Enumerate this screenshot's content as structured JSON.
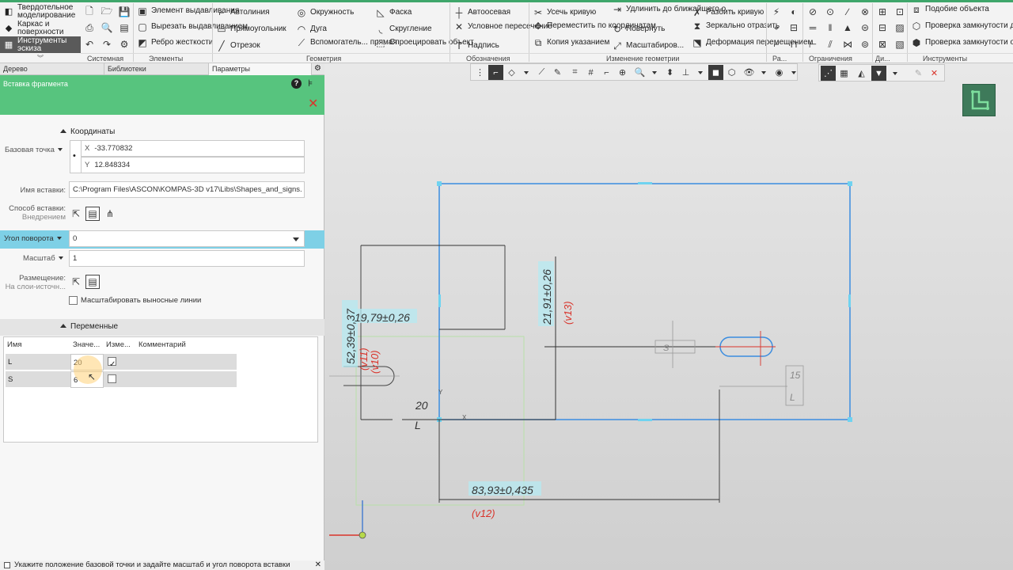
{
  "ribbon": {
    "modes": [
      {
        "label": "Твердотельное моделирование",
        "icon": "solid-model-icon",
        "active": false
      },
      {
        "label": "Каркас и поверхности",
        "icon": "surface-icon",
        "active": false
      },
      {
        "label": "Инструменты эскиза",
        "icon": "sketch-tools-icon",
        "active": true
      }
    ],
    "groups": {
      "system": "Системная",
      "elements": "Элементы",
      "geometry": "Геометрия",
      "notation": "Обозначения",
      "change_geometry": "Изменение геометрии",
      "ra": "Ра...",
      "constraints": "Ограничения",
      "di": "Ди...",
      "tools": "Инструменты"
    },
    "elements": {
      "extrude": "Элемент выдавливания",
      "cut_extrude": "Вырезать выдавливанием",
      "rib": "Ребро жесткости"
    },
    "geometry": {
      "autoline": "Автолиния",
      "rectangle": "Прямоугольник",
      "segment": "Отрезок",
      "circle": "Окружность",
      "arc": "Дуга",
      "aux_line": "Вспомогатель... прямая",
      "chamfer": "Фаска",
      "fillet": "Скругление",
      "copy_object": "Спроецировать объект"
    },
    "notation": {
      "axis": "Автоосевая",
      "cond_intersection": "Условное пересечение",
      "label": "Надпись"
    },
    "change_geometry": {
      "trim": "Усечь кривую",
      "move_coords": "Переместить по координатам",
      "copy_pointing": "Копия указанием",
      "extend": "Удлинить до ближайшего о...",
      "rotate": "Повернуть",
      "scale": "Масштабиров...",
      "split_curve": "Разбить кривую",
      "mirror": "Зеркально отразить",
      "deform_move": "Деформация перемещением"
    },
    "tools": {
      "similarity": "Подобие объекта",
      "closure_check_1": "Проверка замкнутости д...",
      "closure_check_2": "Проверка замкнутости о..."
    }
  },
  "left_panel": {
    "tabs": [
      "Дерево",
      "Библиотеки",
      "Параметры"
    ],
    "header_title": "Вставка фрагмента",
    "coordinates_title": "Координаты",
    "base_point_label": "Базовая точка",
    "x_label": "X",
    "x_value": "-33.770832",
    "y_label": "Y",
    "y_value": "12.848334",
    "insert_name_label": "Имя вставки:",
    "insert_name_value": "C:\\Program Files\\ASCON\\KOMPAS-3D v17\\Libs\\Shapes_and_signs.",
    "insert_method_label": "Способ вставки:",
    "insert_method_value": "Внедрением",
    "rotation_label": "Угол поворота",
    "rotation_value": "0",
    "scale_label": "Масштаб",
    "scale_value": "1",
    "placement_label": "Размещение:",
    "placement_value": "На слои-источн...",
    "scale_leaders_label": "Масштабировать выносные линии",
    "variables_title": "Переменные",
    "table_headers": [
      "Имя",
      "Значе...",
      "Изме...",
      "Комментарий"
    ],
    "variables": [
      {
        "name": "L",
        "value": "20",
        "changed": true
      },
      {
        "name": "S",
        "value": "6",
        "changed": false
      }
    ],
    "status_text": "Укажите положение базовой точки и задайте масштаб и угол поворота вставки"
  },
  "drawing": {
    "dims": {
      "d1": "19,79±0,26",
      "d2": "52,39±0,37",
      "d3": "21,91±0,26",
      "d4": "83,93±0,435",
      "d5": "20",
      "d6": "L",
      "d7": "15",
      "d8": "L",
      "d9": "S"
    },
    "vars": {
      "v11": "(v11)",
      "v10": "(v10)",
      "v13": "(v13)",
      "v12": "(v12)"
    },
    "axis_y": "Y",
    "axis_x": "X"
  },
  "colors": {
    "accent_green": "#57c47e",
    "highlight_blue": "#7ed0e6",
    "sketch_blue": "#3b8de0",
    "red": "#d9342b"
  }
}
